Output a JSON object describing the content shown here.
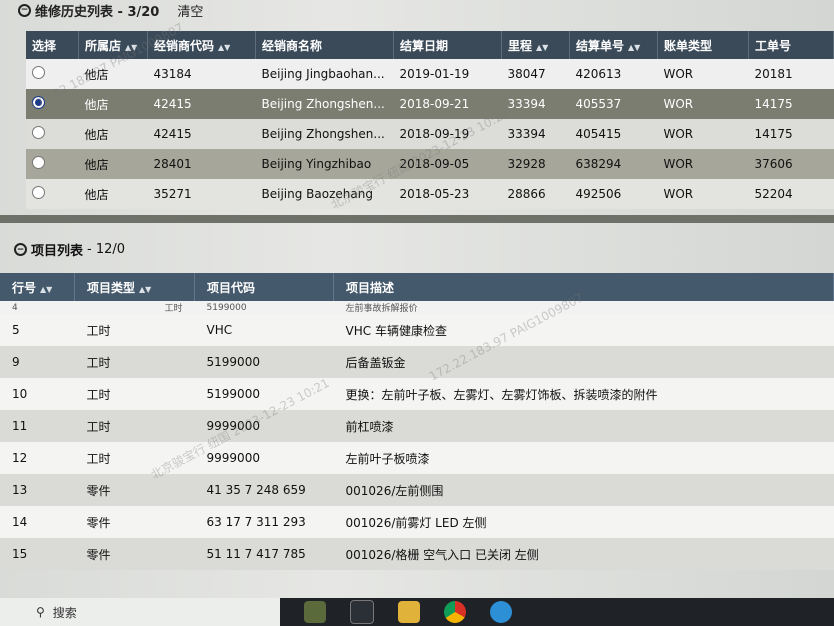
{
  "history": {
    "title": "维修历史列表 - 3/20",
    "clear": "清空",
    "columns": [
      "选择",
      "所属店",
      "经销商代码",
      "经销商名称",
      "结算日期",
      "里程",
      "结算单号",
      "账单类型",
      "工单号"
    ],
    "rows": [
      {
        "store": "他店",
        "code": "43184",
        "name": "Beijing Jingbaohan...",
        "date": "2019-01-19",
        "mileage": "38047",
        "settle": "420613",
        "type": "WOR",
        "order": "20181",
        "selected": false
      },
      {
        "store": "他店",
        "code": "42415",
        "name": "Beijing Zhongshen...",
        "date": "2018-09-21",
        "mileage": "33394",
        "settle": "405537",
        "type": "WOR",
        "order": "14175",
        "selected": true
      },
      {
        "store": "他店",
        "code": "42415",
        "name": "Beijing Zhongshen...",
        "date": "2018-09-19",
        "mileage": "33394",
        "settle": "405415",
        "type": "WOR",
        "order": "14175",
        "selected": false
      },
      {
        "store": "他店",
        "code": "28401",
        "name": "Beijing Yingzhibao",
        "date": "2018-09-05",
        "mileage": "32928",
        "settle": "638294",
        "type": "WOR",
        "order": "37606",
        "selected": false
      },
      {
        "store": "他店",
        "code": "35271",
        "name": "Beijing Baozehang",
        "date": "2018-05-23",
        "mileage": "28866",
        "settle": "492506",
        "type": "WOR",
        "order": "52204",
        "selected": false
      }
    ]
  },
  "items": {
    "title": "项目列表",
    "count": "- 12/0",
    "columns": [
      "行号",
      "项目类型",
      "项目代码",
      "项目描述"
    ],
    "cut_row": {
      "no": "4",
      "type": "工时",
      "code": "5199000",
      "desc": "左前事故拆解报价"
    },
    "rows": [
      {
        "no": "5",
        "type": "工时",
        "code": "VHC",
        "desc": "VHC 车辆健康检查"
      },
      {
        "no": "9",
        "type": "工时",
        "code": "5199000",
        "desc": "后备盖钣金"
      },
      {
        "no": "10",
        "type": "工时",
        "code": "5199000",
        "desc": "更换：左前叶子板、左雾灯、左雾灯饰板、拆装喷漆的附件"
      },
      {
        "no": "11",
        "type": "工时",
        "code": "9999000",
        "desc": "前杠喷漆"
      },
      {
        "no": "12",
        "type": "工时",
        "code": "9999000",
        "desc": "左前叶子板喷漆"
      },
      {
        "no": "13",
        "type": "零件",
        "code": "41 35 7 248 659",
        "desc": "001026/左前侧围"
      },
      {
        "no": "14",
        "type": "零件",
        "code": "63 17 7 311 293",
        "desc": "001026/前雾灯 LED 左侧"
      },
      {
        "no": "15",
        "type": "零件",
        "code": "51 11 7 417 785",
        "desc": "001026/格栅 空气入口 已关闭 左侧"
      }
    ]
  },
  "taskbar": {
    "search_label": "搜索"
  },
  "watermarks": [
    "北京骏宝行 纽国 2023-12-23 10:21",
    "172.22.183.97 PAIG1009807"
  ]
}
